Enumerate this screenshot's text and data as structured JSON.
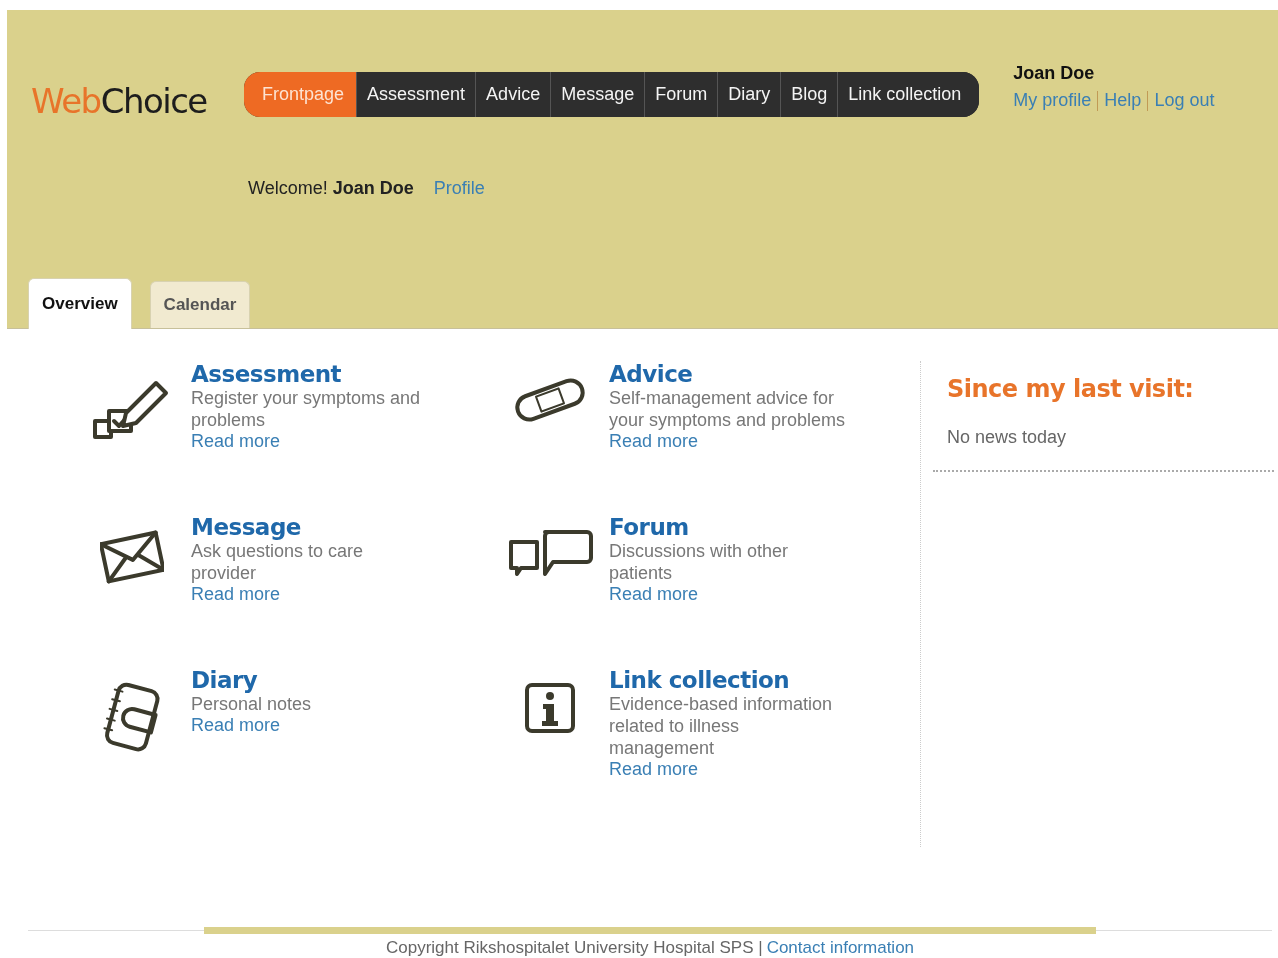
{
  "logo": {
    "part1": "Web",
    "part2": "Choice"
  },
  "nav": [
    {
      "label": "Frontpage",
      "selected": true
    },
    {
      "label": "Assessment",
      "selected": false
    },
    {
      "label": "Advice",
      "selected": false
    },
    {
      "label": "Message",
      "selected": false
    },
    {
      "label": "Forum",
      "selected": false
    },
    {
      "label": "Diary",
      "selected": false
    },
    {
      "label": "Blog",
      "selected": false
    },
    {
      "label": "Link collection",
      "selected": false
    }
  ],
  "user": {
    "name": "Joan Doe",
    "links": [
      "My profile",
      "Help",
      "Log out"
    ]
  },
  "welcome": {
    "text": "Welcome! **Joan Doe**",
    "link": "Profile"
  },
  "tabs": [
    {
      "label": "Overview",
      "selected": true
    },
    {
      "label": "Calendar",
      "selected": false
    }
  ],
  "features": [
    {
      "kind": "assessment",
      "title": "Assessment",
      "description": "Register your symptoms and problems",
      "link": "Read more"
    },
    {
      "kind": "advice",
      "title": "Advice",
      "description": "Self-management advice for your symptoms and problems",
      "link": "Read more"
    },
    {
      "kind": "message",
      "title": "Message",
      "description": "Ask questions to care provider",
      "link": "Read more"
    },
    {
      "kind": "forum",
      "title": "Forum",
      "description": "Discussions with other patients",
      "link": "Read more"
    },
    {
      "kind": "diary",
      "title": "Diary",
      "description": "Personal notes",
      "link": "Read more"
    },
    {
      "kind": "links",
      "title": "Link collection",
      "description": "Evidence-based information related to illness management",
      "link": "Read more"
    }
  ],
  "news": {
    "title": "Since my last visit:",
    "text": "No news today"
  },
  "footer": {
    "text": "Copyright Rikshospitalet University Hospital SPS |",
    "link": "Contact information"
  }
}
